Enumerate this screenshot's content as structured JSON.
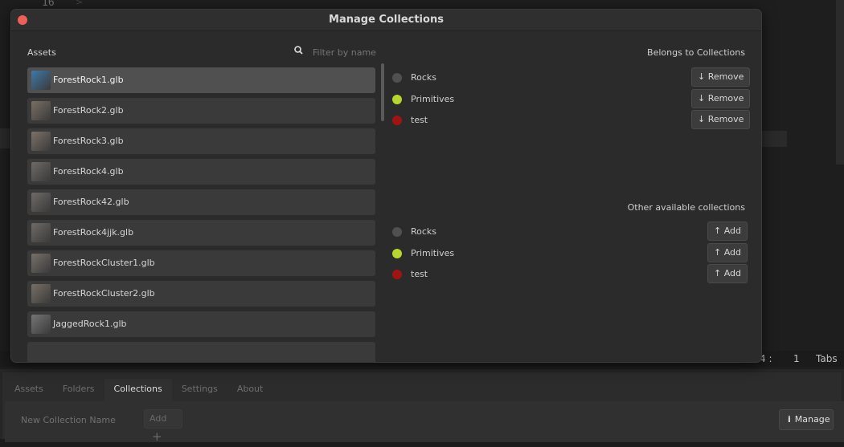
{
  "editor": {
    "line_number": "16",
    "status_col": "4 :",
    "status_line": "1",
    "status_tabs": "Tabs"
  },
  "bottom_panel": {
    "tabs": [
      {
        "label": "Assets"
      },
      {
        "label": "Folders"
      },
      {
        "label": "Collections"
      },
      {
        "label": "Settings"
      },
      {
        "label": "About"
      }
    ],
    "new_collection_placeholder": "New Collection Name",
    "add_label": "Add",
    "manage_label": "Manage"
  },
  "modal": {
    "title": "Manage Collections",
    "assets_label": "Assets",
    "filter_placeholder": "Filter by name",
    "assets": [
      {
        "name": "ForestRock1.glb",
        "thumb_color": "#3f79a8"
      },
      {
        "name": "ForestRock2.glb",
        "thumb_color": "#7a6f63"
      },
      {
        "name": "ForestRock3.glb",
        "thumb_color": "#7d7166"
      },
      {
        "name": "ForestRock4.glb",
        "thumb_color": "#6e6a66"
      },
      {
        "name": "ForestRock42.glb",
        "thumb_color": "#6e6a66"
      },
      {
        "name": "ForestRock4jjk.glb",
        "thumb_color": "#6e6a66"
      },
      {
        "name": "ForestRockCluster1.glb",
        "thumb_color": "#777068"
      },
      {
        "name": "ForestRockCluster2.glb",
        "thumb_color": "#786f65"
      },
      {
        "name": "JaggedRock1.glb",
        "thumb_color": "#757575"
      }
    ],
    "belongs_label": "Belongs to Collections",
    "belongs": [
      {
        "name": "Rocks",
        "color": "#505050",
        "action": "Remove"
      },
      {
        "name": "Primitives",
        "color": "#b6d62b",
        "action": "Remove"
      },
      {
        "name": "test",
        "color": "#a01414",
        "action": "Remove"
      }
    ],
    "other_label": "Other available collections",
    "others": [
      {
        "name": "Rocks",
        "color": "#505050",
        "action": "Add"
      },
      {
        "name": "Primitives",
        "color": "#b6d62b",
        "action": "Add"
      },
      {
        "name": "test",
        "color": "#a01414",
        "action": "Add"
      }
    ]
  }
}
